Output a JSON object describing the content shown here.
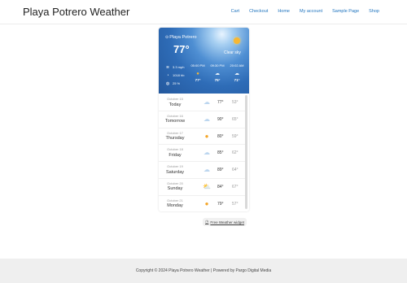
{
  "site": {
    "title": "Playa Potrero Weather"
  },
  "nav": [
    "Cart",
    "Checkout",
    "Home",
    "My account",
    "Sample Page",
    "Shop"
  ],
  "widget": {
    "location": "Playa Potrero",
    "current_temp": "77°",
    "condition": "Clear sky",
    "wind": "3.3 mph",
    "pressure": "1018 hb",
    "humidity": "25 %",
    "hourly": [
      {
        "time": "05:00 PM",
        "icon": "sun-icon",
        "temp": "77°"
      },
      {
        "time": "09:30 PM",
        "icon": "cloud-icon",
        "temp": "75°"
      },
      {
        "time": "20:02 AM",
        "icon": "cloud-icon",
        "temp": "71°"
      }
    ],
    "daily": [
      {
        "date": "October 15",
        "day": "Today",
        "icon": "cloud-icon",
        "hi": "77°",
        "lo": "53°"
      },
      {
        "date": "October 16",
        "day": "Tomorrow",
        "icon": "cloud-icon",
        "hi": "90°",
        "lo": "65°"
      },
      {
        "date": "October 17",
        "day": "Thursday",
        "icon": "sun-icon",
        "hi": "80°",
        "lo": "59°"
      },
      {
        "date": "October 18",
        "day": "Friday",
        "icon": "cloud-icon",
        "hi": "85°",
        "lo": "62°"
      },
      {
        "date": "October 19",
        "day": "Saturday",
        "icon": "cloud-icon",
        "hi": "89°",
        "lo": "64°"
      },
      {
        "date": "October 20",
        "day": "Sunday",
        "icon": "partly-cloudy-icon",
        "hi": "84°",
        "lo": "67°"
      },
      {
        "date": "October 21",
        "day": "Monday",
        "icon": "sun-icon",
        "hi": "79°",
        "lo": "57°"
      }
    ]
  },
  "badge": {
    "label": "Free Weather widget"
  },
  "footer": {
    "text": "Copyright © 2024 Playa Potrero Weather | Powered by Pargo Digital Media"
  }
}
